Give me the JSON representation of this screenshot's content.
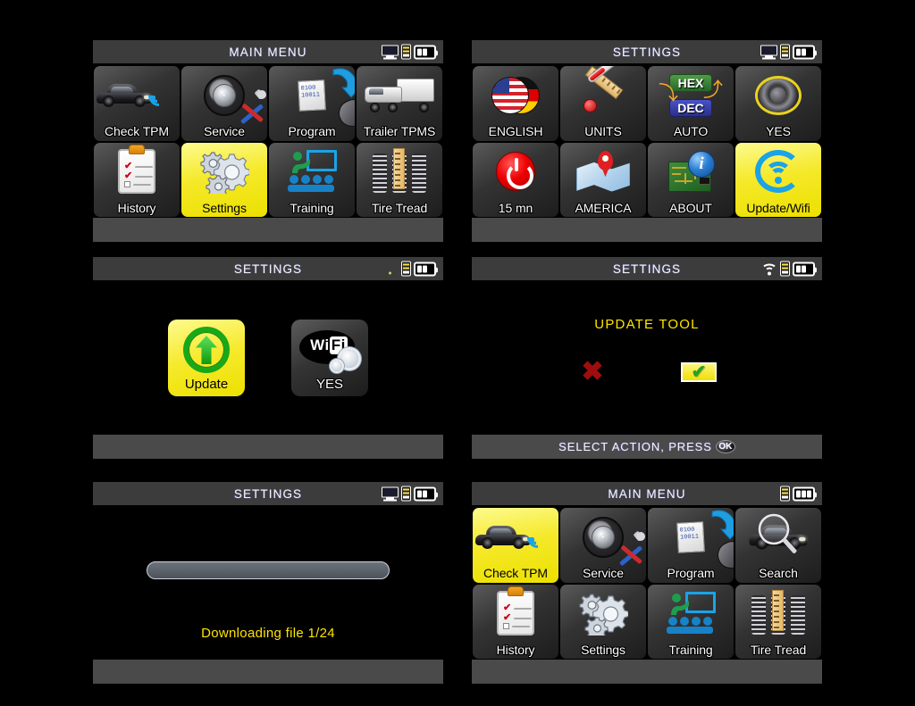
{
  "device": "TPMS diagnostic tool",
  "colors": {
    "selected_tile": "#f5e92a",
    "yellow_text": "#ffe400",
    "titlebar": "#3c3c3c",
    "footer": "#4a4a4a",
    "screen_bg": "#000000",
    "accent_blue": "#1aa3e8",
    "green": "#18a818",
    "red": "#9e0e0e"
  },
  "panels": [
    {
      "id": "main-menu-settings-selected",
      "title": "MAIN MENU",
      "status_icons": [
        "monitor-icon",
        "tool-icon",
        "battery-icon"
      ],
      "battery_bars": 2,
      "footer": "",
      "tiles": [
        {
          "label": "Check TPM",
          "icon": "car-signal-icon",
          "selected": false
        },
        {
          "label": "Service",
          "icon": "tire-tools-icon",
          "selected": false
        },
        {
          "label": "Program",
          "icon": "program-sensor-icon",
          "selected": false
        },
        {
          "label": "Trailer TPMS",
          "icon": "truck-signal-icon",
          "selected": false
        },
        {
          "label": "History",
          "icon": "clipboard-icon",
          "selected": false
        },
        {
          "label": "Settings",
          "icon": "gears-icon",
          "selected": true
        },
        {
          "label": "Training",
          "icon": "training-icon",
          "selected": false
        },
        {
          "label": "Tire Tread",
          "icon": "tire-tread-icon",
          "selected": false
        }
      ]
    },
    {
      "id": "settings-menu-updatewifi-selected",
      "title": "SETTINGS",
      "status_icons": [
        "monitor-icon",
        "tool-icon",
        "battery-icon"
      ],
      "battery_bars": 2,
      "footer": "",
      "tiles": [
        {
          "label": "ENGLISH",
          "icon": "flags-icon",
          "selected": false
        },
        {
          "label": "UNITS",
          "icon": "units-icon",
          "selected": false
        },
        {
          "label": "AUTO",
          "icon": "hex-dec-icon",
          "selected": false
        },
        {
          "label": "YES",
          "icon": "speaker-icon",
          "selected": false
        },
        {
          "label": "15 mn",
          "icon": "power-icon",
          "selected": false
        },
        {
          "label": "AMERICA",
          "icon": "map-pin-icon",
          "selected": false
        },
        {
          "label": "ABOUT",
          "icon": "about-info-icon",
          "selected": false
        },
        {
          "label": "Update/Wifi",
          "icon": "update-wifi-icon",
          "selected": true
        }
      ]
    },
    {
      "id": "settings-update-wifi",
      "title": "SETTINGS",
      "status_icons": [
        "weak-signal-dot-icon",
        "tool-icon",
        "battery-icon"
      ],
      "battery_bars": 2,
      "footer": "",
      "tiles": [
        {
          "label": "Update",
          "icon": "green-up-arrow-icon",
          "selected": true
        },
        {
          "label": "YES",
          "icon": "wifi-gear-icon",
          "selected": false
        }
      ]
    },
    {
      "id": "settings-update-tool-confirm",
      "title": "SETTINGS",
      "status_icons": [
        "wifi-icon",
        "tool-icon",
        "battery-icon"
      ],
      "battery_bars": 2,
      "message": "UPDATE TOOL",
      "cancel_glyph": "✖",
      "confirm_glyph": "✔",
      "footer": "SELECT ACTION, PRESS",
      "footer_button": "OK"
    },
    {
      "id": "settings-downloading",
      "title": "SETTINGS",
      "status_icons": [
        "monitor-icon",
        "tool-icon",
        "battery-icon"
      ],
      "battery_bars": 2,
      "progress_percent": 0,
      "status_text": "Downloading file 1/24",
      "footer": ""
    },
    {
      "id": "main-menu-checktpm-selected",
      "title": "MAIN MENU",
      "status_icons": [
        "tool-icon",
        "battery-icon"
      ],
      "battery_bars": 3,
      "footer": "",
      "tiles": [
        {
          "label": "Check TPM",
          "icon": "car-signal-icon",
          "selected": true
        },
        {
          "label": "Service",
          "icon": "tire-tools-icon",
          "selected": false
        },
        {
          "label": "Program",
          "icon": "program-sensor-icon",
          "selected": false
        },
        {
          "label": "Search",
          "icon": "car-magnifier-icon",
          "selected": false
        },
        {
          "label": "History",
          "icon": "clipboard-icon",
          "selected": false
        },
        {
          "label": "Settings",
          "icon": "gears-icon",
          "selected": false
        },
        {
          "label": "Training",
          "icon": "training-icon",
          "selected": false
        },
        {
          "label": "Tire Tread",
          "icon": "tire-tread-icon",
          "selected": false
        }
      ]
    }
  ],
  "program_tile_bits": [
    "0100",
    "10011"
  ]
}
